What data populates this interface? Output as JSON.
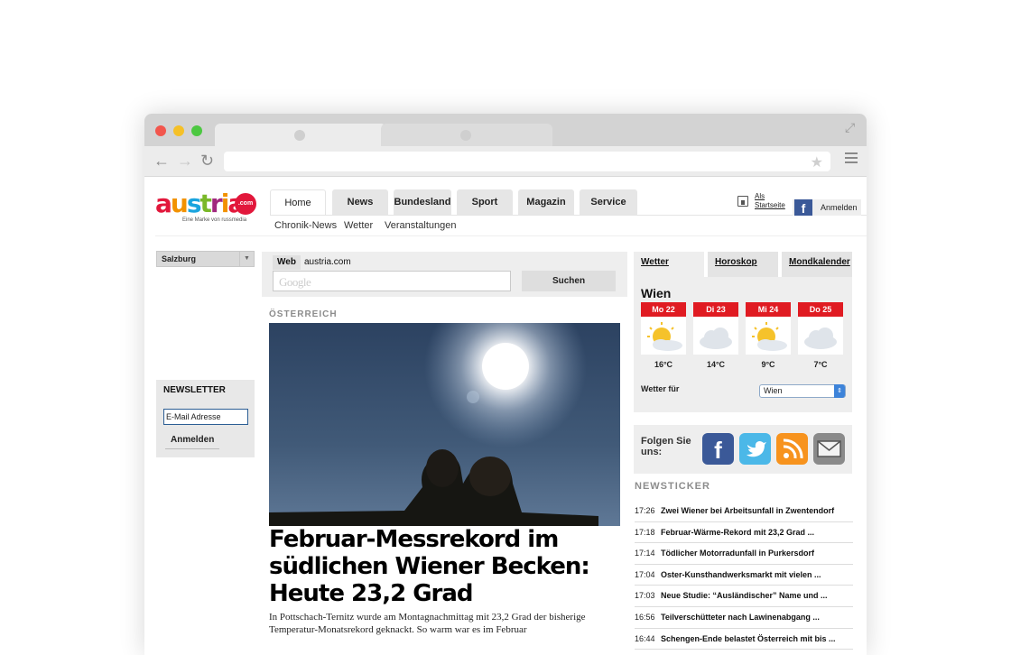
{
  "browser": {
    "star_glyph": "★",
    "fullscreen_glyph": "⤢",
    "back_glyph": "←",
    "forward_glyph": "→",
    "reload_glyph": "↻"
  },
  "header": {
    "logo": {
      "wordmark": "austria",
      "badge": ".com",
      "tagline": "Eine Marke von russmedia",
      "colors": [
        "#e2173b",
        "#f29200",
        "#1aa4de",
        "#7ab829",
        "#a1287e"
      ]
    },
    "main_nav": [
      "Home",
      "News",
      "Bundesland",
      "Sport",
      "Magazin",
      "Service"
    ],
    "sub_nav": [
      "Chronik-News",
      "Wetter",
      "Veranstaltungen"
    ],
    "home_link": "Als Startseite",
    "login_label": "Anmelden"
  },
  "sidebar_left": {
    "region_select": "Salzburg",
    "newsletter": {
      "title": "NEWSLETTER",
      "input_value": "E-Mail Adresse",
      "button": "Anmelden"
    }
  },
  "search": {
    "tab_web": "Web",
    "tab_site": "austria.com",
    "placeholder_logo": "Google",
    "button": "Suchen"
  },
  "article": {
    "kicker": "ÖSTERREICH",
    "headline": "Februar-Messrekord im südlichen Wiener Becken: Heute 23,2 Grad",
    "teaser": "In Pottschach-Ternitz wurde am Montagnachmittag mit 23,2 Grad der bisherige Temperatur-Monatsrekord geknackt. So warm war es im Februar"
  },
  "weather": {
    "tabs": [
      "Wetter",
      "Horoskop",
      "Mondkalender"
    ],
    "city": "Wien",
    "days": [
      {
        "label": "Mo 22",
        "temp": "16°C",
        "icon": "sun-cloud-icon"
      },
      {
        "label": "Di 23",
        "temp": "14°C",
        "icon": "cloud-icon"
      },
      {
        "label": "Mi 24",
        "temp": "9°C",
        "icon": "sun-cloud-icon"
      },
      {
        "label": "Do 25",
        "temp": "7°C",
        "icon": "cloud-icon"
      }
    ],
    "for_label": "Wetter für",
    "select_value": "Wien"
  },
  "social": {
    "label": "Folgen Sie uns:",
    "icons": [
      "facebook-icon",
      "twitter-icon",
      "rss-icon",
      "mail-icon"
    ]
  },
  "newsticker": {
    "title": "NEWSTICKER",
    "items": [
      {
        "time": "17:26",
        "text": "Zwei Wiener bei Arbeitsunfall in Zwentendorf"
      },
      {
        "time": "17:18",
        "text": "Februar-Wärme-Rekord mit 23,2 Grad ..."
      },
      {
        "time": "17:14",
        "text": "Tödlicher Motorradunfall in Purkersdorf"
      },
      {
        "time": "17:04",
        "text": "Oster-Kunsthandwerksmarkt mit vielen ..."
      },
      {
        "time": "17:03",
        "text": "Neue Studie: “Ausländischer” Name und ..."
      },
      {
        "time": "16:56",
        "text": "Teilverschütteter nach Lawinenabgang ..."
      },
      {
        "time": "16:44",
        "text": "Schengen-Ende belastet Österreich mit bis ..."
      }
    ]
  }
}
